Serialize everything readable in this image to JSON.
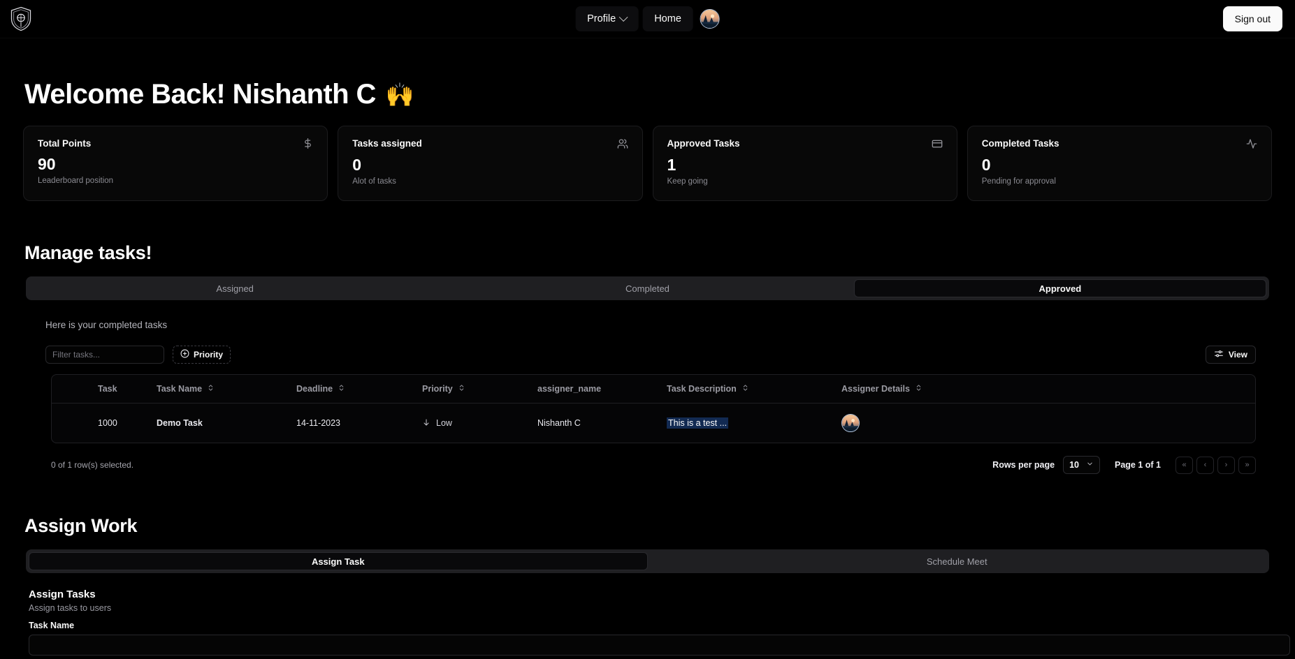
{
  "header": {
    "logo_name": "shield-logo",
    "profile_label": "Profile",
    "home_label": "Home",
    "signout_label": "Sign out"
  },
  "welcome": {
    "greeting": "Welcome Back! Nishanth C",
    "emoji": "🙌"
  },
  "stats": [
    {
      "title": "Total Points",
      "value": "90",
      "sub": "Leaderboard position",
      "icon": "dollar-icon"
    },
    {
      "title": "Tasks assigned",
      "value": "0",
      "sub": "Alot of tasks",
      "icon": "users-icon"
    },
    {
      "title": "Approved Tasks",
      "value": "1",
      "sub": "Keep going",
      "icon": "credit-card-icon"
    },
    {
      "title": "Completed Tasks",
      "value": "0",
      "sub": "Pending for approval",
      "icon": "activity-icon"
    }
  ],
  "manage": {
    "title": "Manage tasks!",
    "tabs": [
      {
        "label": "Assigned",
        "active": false
      },
      {
        "label": "Completed",
        "active": false
      },
      {
        "label": "Approved",
        "active": true
      }
    ],
    "helper_text": "Here is your completed tasks",
    "toolbar": {
      "filter_placeholder": "Filter tasks...",
      "filter_value": "",
      "priority_label": "Priority",
      "view_label": "View"
    },
    "table": {
      "columns": [
        {
          "label": "Task",
          "sortable": false
        },
        {
          "label": "Task Name",
          "sortable": true
        },
        {
          "label": "Deadline",
          "sortable": true
        },
        {
          "label": "Priority",
          "sortable": true
        },
        {
          "label": "assigner_name",
          "sortable": false
        },
        {
          "label": "Task Description",
          "sortable": true
        },
        {
          "label": "Assigner Details",
          "sortable": true
        }
      ],
      "rows": [
        {
          "task": "1000",
          "task_name": "Demo Task",
          "deadline": "14-11-2023",
          "priority": "Low",
          "priority_icon": "arrow-down-icon",
          "assigner_name": "Nishanth C",
          "description": "This is a test ...",
          "assigner_avatar": "user-avatar"
        }
      ]
    },
    "pagination": {
      "rows_selected": "0 of 1 row(s) selected.",
      "rows_per_page_label": "Rows per page",
      "rows_per_page_value": "10",
      "page_label": "Page 1 of 1",
      "first_icon": "«",
      "prev_icon": "‹",
      "next_icon": "›",
      "last_icon": "»"
    }
  },
  "assign": {
    "title": "Assign Work",
    "tabs": [
      {
        "label": "Assign Task",
        "active": true
      },
      {
        "label": "Schedule Meet",
        "active": false
      }
    ],
    "form": {
      "title": "Assign Tasks",
      "subtitle": "Assign tasks to users",
      "task_name_label": "Task Name",
      "task_name_value": ""
    }
  },
  "colors": {
    "background": "#000000",
    "card_bg": "#080808",
    "border": "#1c1c1e",
    "text": "#fafafa",
    "muted": "#8b8b92",
    "accent": "#ffffff",
    "highlight": "#122a52"
  }
}
